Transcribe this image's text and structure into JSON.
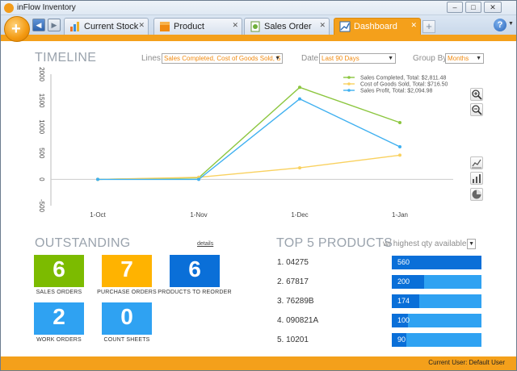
{
  "window": {
    "title": "inFlow Inventory"
  },
  "window_controls": {
    "minimize": "–",
    "maximize": "□",
    "close": "✕"
  },
  "nav": {
    "back": "◀",
    "forward": "▶"
  },
  "tabs": [
    {
      "label": "Current Stock",
      "icon": "stock-chart-icon",
      "active": false
    },
    {
      "label": "Product",
      "icon": "product-box-icon",
      "active": false
    },
    {
      "label": "Sales Order",
      "icon": "sales-order-icon",
      "active": false
    },
    {
      "label": "Dashboard",
      "icon": "dashboard-icon",
      "active": true
    }
  ],
  "tab_close": "✕",
  "help": {
    "label": "?",
    "caret": "▼"
  },
  "add_tab": "+",
  "timeline": {
    "title": "TIMELINE",
    "lines_label": "Lines",
    "lines_value": "Sales Completed, Cost of Goods Sold, S",
    "date_label": "Date",
    "date_value": "Last 90 Days",
    "groupby_label": "Group By",
    "groupby_value": "Months",
    "caret": "▼"
  },
  "chart_data": {
    "type": "line",
    "categories": [
      "1-Oct",
      "1-Nov",
      "1-Dec",
      "1-Jan"
    ],
    "y_ticks": [
      "-500",
      "0",
      "500",
      "1000",
      "1500",
      "2000"
    ],
    "y_tick_values": [
      -500,
      0,
      500,
      1000,
      1500,
      2000
    ],
    "ylim": [
      -500,
      2000
    ],
    "grid": false,
    "legend_position": "top-right",
    "series": [
      {
        "name": "Sales Completed, Total: $2,811.48",
        "color": "#8cc63f",
        "values": [
          0,
          30,
          1750,
          1080
        ]
      },
      {
        "name": "Cost of Goods Sold, Total: $716.50",
        "color": "#f9d15f",
        "values": [
          0,
          40,
          220,
          460
        ]
      },
      {
        "name": "Sales Profit, Total: $2,094.98",
        "color": "#3fb0f0",
        "values": [
          0,
          0,
          1530,
          620
        ]
      }
    ]
  },
  "chart_tools": [
    "zoom-in-icon",
    "zoom-out-icon",
    "line-chart-icon",
    "bar-chart-icon",
    "pie-chart-icon"
  ],
  "outstanding": {
    "title": "OUTSTANDING",
    "details_link": "details",
    "tiles": [
      {
        "value": "6",
        "label": "SALES ORDERS",
        "color": "#7cbb00"
      },
      {
        "value": "7",
        "label": "PURCHASE ORDERS",
        "color": "#ffb300"
      },
      {
        "value": "6",
        "label": "PRODUCTS TO REORDER",
        "color": "#0a6fd8"
      },
      {
        "value": "2",
        "label": "WORK ORDERS",
        "color": "#2fa2f2"
      },
      {
        "value": "0",
        "label": "COUNT SHEETS",
        "color": "#2fa2f2"
      }
    ]
  },
  "top5": {
    "title": "TOP 5 PRODUCTS",
    "subtitle": "w/ highest qty available",
    "caret": "▼",
    "items": [
      {
        "name": "1. 04275",
        "value": "560",
        "fraction": 1.0
      },
      {
        "name": "2. 67817",
        "value": "200",
        "fraction": 0.36
      },
      {
        "name": "3. 76289B",
        "value": "174",
        "fraction": 0.31
      },
      {
        "name": "4. 090821A",
        "value": "100",
        "fraction": 0.18
      },
      {
        "name": "5. 10201",
        "value": "90",
        "fraction": 0.16
      }
    ]
  },
  "status": {
    "text": "Current User:   Default User"
  }
}
